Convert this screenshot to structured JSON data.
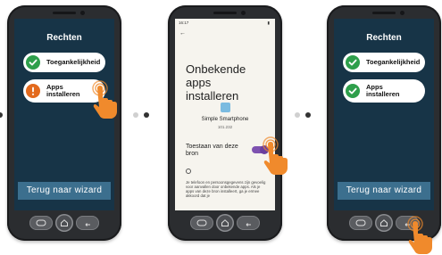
{
  "screen1": {
    "title": "Rechten",
    "items": [
      {
        "label": "Toegankelijkheid",
        "status": "ok"
      },
      {
        "label_line1": "Apps",
        "label_line2": "installeren",
        "status": "warning"
      }
    ],
    "wizard_button": "Terug naar wizard"
  },
  "screen2": {
    "status_time": "16:17",
    "title_line1": "Onbekende apps",
    "title_line2": "installeren",
    "app_name": "Simple Smartphone",
    "app_version": "101.232",
    "toggle_label_line1": "Toestaan van deze",
    "toggle_label_line2": "bron",
    "toggle_on": true,
    "info_text": "Je telefoon en persoonsgegevens zijn gevoelig voor aanvallen door onbekende apps. Als je apps van deze bron installeert, ga je ermee akkoord dat je"
  },
  "screen3": {
    "title": "Rechten",
    "items": [
      {
        "label": "Toegankelijkheid",
        "status": "ok"
      },
      {
        "label_line1": "Apps",
        "label_line2": "installeren",
        "status": "ok"
      }
    ],
    "wizard_button": "Terug naar wizard"
  },
  "colors": {
    "screen_bg": "#173447",
    "ok": "#2e9f4b",
    "warning": "#e36a1d",
    "wizard": "#3c6f8e",
    "hand": "#f08a2c",
    "toggle": "#7e52b0"
  },
  "icons": [
    "check-icon",
    "exclamation-icon",
    "back-icon",
    "home-icon",
    "menu-icon",
    "pointing-hand-icon",
    "info-icon",
    "arrow-left-icon"
  ]
}
